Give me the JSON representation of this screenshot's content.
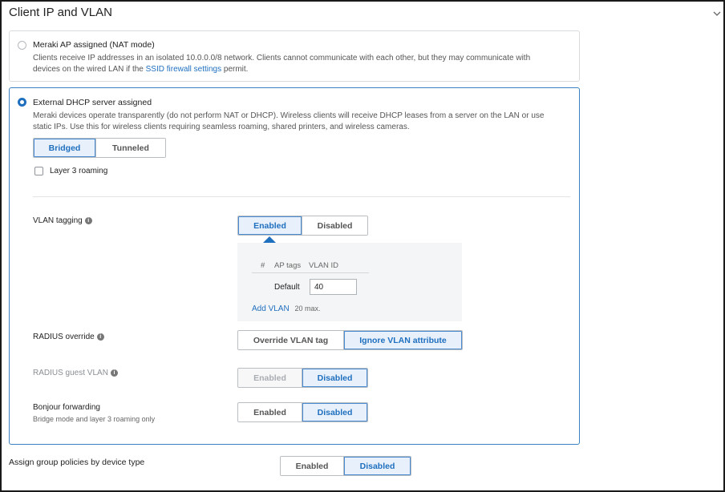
{
  "section": {
    "title": "Client IP and VLAN",
    "collapse_icon": "chevron-down-icon"
  },
  "nat_mode": {
    "label": "Meraki AP assigned (NAT mode)",
    "desc_line1": "Clients receive IP addresses in an isolated 10.0.0.0/8 network. Clients cannot communicate with each other, but they may communicate with",
    "desc_pre": "devices on the wired LAN if the ",
    "desc_link": "SSID firewall settings",
    "desc_post": " permit.",
    "selected": false
  },
  "external_dhcp": {
    "label": "External DHCP server assigned",
    "desc_line1": "Meraki devices operate transparently (do not perform NAT or DHCP). Wireless clients will receive DHCP leases from a server on the LAN or use",
    "desc_line2": "static IPs. Use this for wireless clients requiring seamless roaming, shared printers, and wireless cameras.",
    "selected": true,
    "mode_toggle": {
      "bridged": "Bridged",
      "tunneled": "Tunneled",
      "selected": "Bridged"
    },
    "layer3_roaming": {
      "label": "Layer 3 roaming",
      "checked": false
    }
  },
  "vlan_tagging": {
    "label": "VLAN tagging",
    "enabled": "Enabled",
    "disabled": "Disabled",
    "selected": "Enabled",
    "table": {
      "headers": [
        "#",
        "AP tags",
        "VLAN ID"
      ],
      "row_label": "Default",
      "vlan_id": "40",
      "add_link": "Add VLAN",
      "max_note": "20 max."
    }
  },
  "radius_override": {
    "label": "RADIUS override",
    "override": "Override VLAN tag",
    "ignore": "Ignore VLAN attribute",
    "selected": "Ignore VLAN attribute"
  },
  "radius_guest_vlan": {
    "label": "RADIUS guest VLAN",
    "enabled": "Enabled",
    "disabled": "Disabled",
    "selected": "Disabled"
  },
  "bonjour": {
    "label": "Bonjour forwarding",
    "sublabel": "Bridge mode and layer 3 roaming only",
    "enabled": "Enabled",
    "disabled": "Disabled",
    "selected": "Disabled"
  },
  "group_policies": {
    "label": "Assign group policies by device type",
    "enabled": "Enabled",
    "disabled": "Disabled",
    "selected": "Disabled"
  },
  "colors": {
    "accent": "#1f6fbf",
    "selected_bg": "#e8f1fb",
    "border": "#b9bec3"
  }
}
